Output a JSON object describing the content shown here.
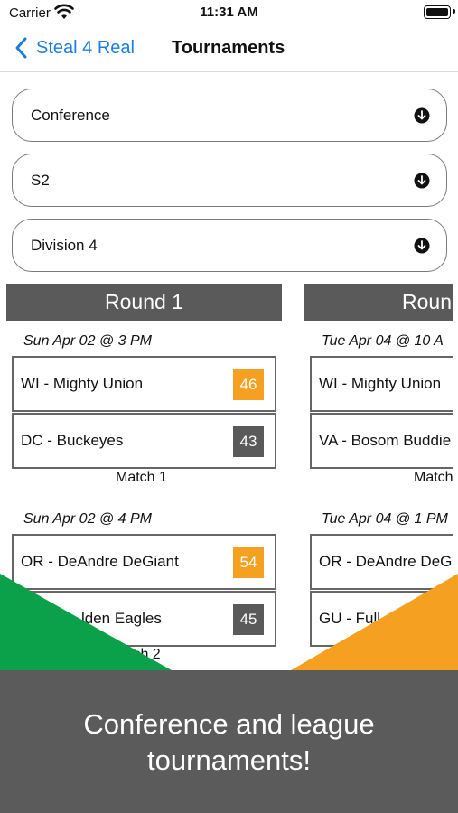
{
  "status_bar": {
    "carrier": "Carrier",
    "time": "11:31 AM"
  },
  "nav": {
    "back_label": "Steal 4 Real",
    "title": "Tournaments"
  },
  "filters": [
    {
      "label": "Conference"
    },
    {
      "label": "S2"
    },
    {
      "label": "Division 4"
    }
  ],
  "rounds": [
    {
      "title": "Round 1",
      "matches": [
        {
          "date": "Sun Apr 02 @ 3 PM",
          "teams": [
            {
              "name": "WI - Mighty Union",
              "score": "46"
            },
            {
              "name": "DC - Buckeyes",
              "score": "43"
            }
          ],
          "label": "Match 1"
        },
        {
          "date": "Sun Apr 02 @ 4 PM",
          "teams": [
            {
              "name": "OR - DeAndre DeGiant",
              "score": "54"
            },
            {
              "name": "lden Eagles",
              "score": "45"
            }
          ],
          "label": "tch 2"
        }
      ]
    },
    {
      "title": "Roun",
      "matches": [
        {
          "date": "Tue Apr 04 @ 10 A",
          "teams": [
            {
              "name": "WI - Mighty Union"
            },
            {
              "name": "VA - Bosom Buddie"
            }
          ],
          "label": "Match"
        },
        {
          "date": "Tue Apr 04 @ 1 PM",
          "teams": [
            {
              "name": "OR - DeAndre DeG"
            },
            {
              "name": "GU - Full"
            }
          ]
        }
      ]
    }
  ],
  "banner": {
    "line1": "Conference and league",
    "line2": "tournaments!"
  },
  "colors": {
    "accent_blue": "#1a7de3",
    "win_orange": "#f5a021",
    "lose_gray": "#5a5a5a",
    "green": "#0ba14b",
    "banner_gray": "#5b5b5b"
  }
}
